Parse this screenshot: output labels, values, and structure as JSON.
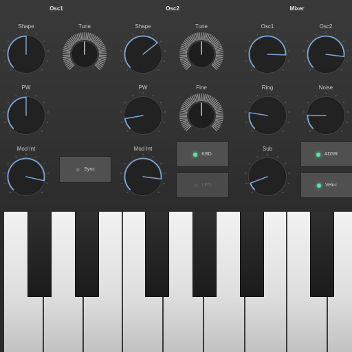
{
  "sections": {
    "osc1": "Osc1",
    "osc2": "Osc2",
    "mixer": "Mixer"
  },
  "osc1": {
    "shape_label": "Shape",
    "tune_label": "Tune",
    "pw_label": "PW",
    "mod_int_label": "Mod Int",
    "sync_label": "Sync",
    "shape_value": 0.5,
    "tune_value": 0.5,
    "pw_value": 0.5,
    "mod_int_value": 0.88
  },
  "osc2": {
    "shape_label": "Shape",
    "tune_label": "Tune",
    "pw_label": "PW",
    "fine_label": "Fine",
    "mod_int_label": "Mod Int",
    "kbd_label": "KBD",
    "lfo_label": "LFO",
    "shape_value": 0.69,
    "tune_value": 0.5,
    "pw_value": 0.13,
    "fine_value": 0.5,
    "mod_int_value": 0.86
  },
  "mixer": {
    "osc1_label": "Osc1",
    "osc2_label": "Osc2",
    "ring_label": "Ring",
    "noise_label": "Noise",
    "sub_label": "Sub",
    "adsr_label": "ADSR",
    "veloc_label": "Veloc",
    "osc1_value": 0.84,
    "osc2_value": 0.86,
    "ring_value": 0.2,
    "noise_value": 0.17,
    "sub_value": 0.09
  },
  "buttons": {
    "sync_on": false,
    "kbd_on": true,
    "lfo_on": false,
    "adsr_on": true,
    "veloc_on": true
  },
  "colors": {
    "accent": "#7aa6d6",
    "led_on": "#5de3a0",
    "panel": "#363636"
  }
}
